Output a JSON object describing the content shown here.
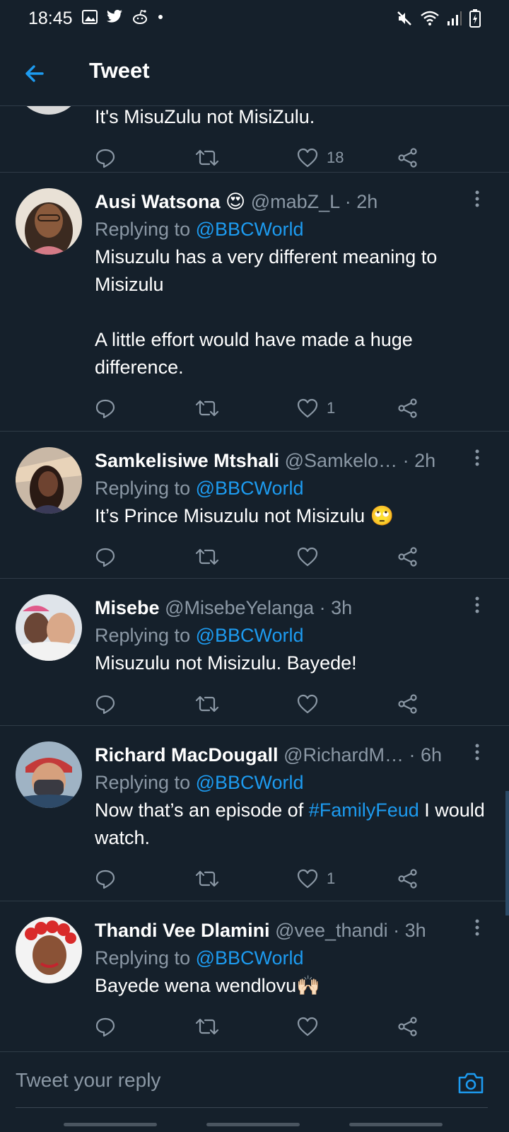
{
  "status_bar": {
    "time": "18:45",
    "left_icons": [
      "image-icon",
      "twitter-bird-icon",
      "reddit-icon",
      "dot-icon"
    ],
    "right_icons": [
      "mute-icon",
      "wifi-icon",
      "signal-icon",
      "battery-icon"
    ]
  },
  "header": {
    "title": "Tweet",
    "back_icon": "back-arrow-icon"
  },
  "colors": {
    "background": "#15202b",
    "accent": "#1d9bf0",
    "muted": "#8b98a5",
    "divider": "#2f3b47"
  },
  "tweets": [
    {
      "body": "It's MisuZulu not MisiZulu.",
      "likes": "18"
    },
    {
      "name": "Ausi Watsona",
      "emoji": "😍",
      "handle": "@mabZ_L",
      "time": "· 2h",
      "replying_label": "Replying to",
      "mention": "@BBCWorld",
      "body": "Misuzulu has a very different meaning to Misizulu\n\nA little effort would have made a huge difference.",
      "likes": "1"
    },
    {
      "name": "Samkelisiwe Mtshali",
      "handle": "@Samkelo…",
      "time": "· 2h",
      "replying_label": "Replying to",
      "mention": "@BBCWorld",
      "body": "It’s Prince Misuzulu not Misizulu",
      "emoji": "🙄",
      "likes": ""
    },
    {
      "name": "Misebe",
      "handle": "@MisebeYelanga",
      "time": "· 3h",
      "replying_label": "Replying to",
      "mention": "@BBCWorld",
      "body": "Misuzulu not Misizulu. Bayede!",
      "likes": ""
    },
    {
      "name": "Richard MacDougall",
      "handle": "@RichardM…",
      "time": "· 6h",
      "replying_label": "Replying to",
      "mention": "@BBCWorld",
      "body_before": "Now that’s an episode of ",
      "hashtag": "#FamilyFeud",
      "body_after": " I would watch.",
      "likes": "1"
    },
    {
      "name": "Thandi Vee Dlamini",
      "handle": "@vee_thandi",
      "time": "· 3h",
      "replying_label": "Replying to",
      "mention": "@BBCWorld",
      "body": "Bayede wena wendlovu",
      "emoji": "🙌🏻",
      "likes": ""
    }
  ],
  "reply_bar": {
    "placeholder": "Tweet your reply",
    "camera_icon": "camera-icon"
  }
}
